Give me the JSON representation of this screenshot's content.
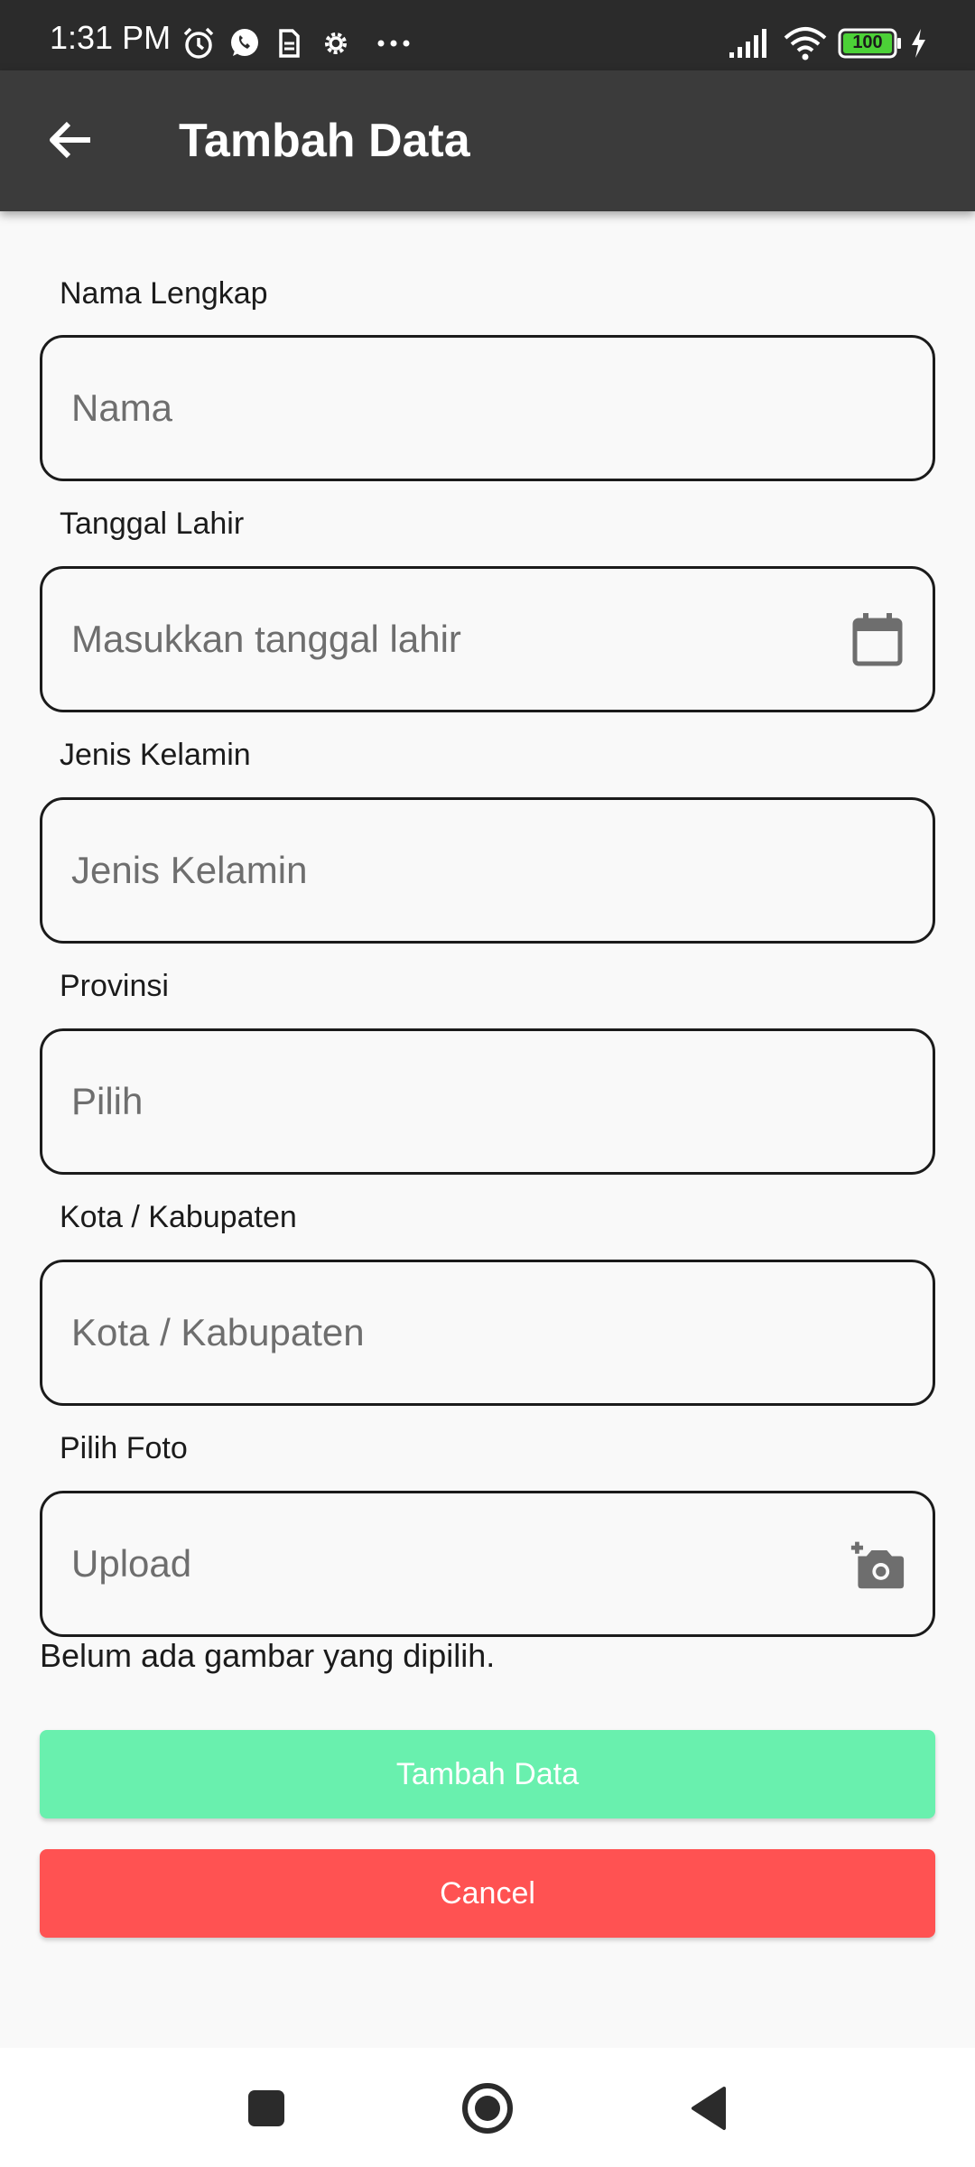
{
  "status_bar": {
    "time": "1:31 PM",
    "battery": "100",
    "icons": [
      "alarm-icon",
      "whatsapp-icon",
      "sim-icon",
      "settings-icon",
      "more-dots-icon",
      "signal-icon",
      "wifi-icon",
      "battery-icon",
      "charging-icon"
    ]
  },
  "app_bar": {
    "title": "Tambah Data",
    "back_icon": "arrow-back-icon"
  },
  "form": {
    "fields": [
      {
        "label": "Nama Lengkap",
        "placeholder": "Nama"
      },
      {
        "label": "Tanggal Lahir",
        "placeholder": "Masukkan tanggal lahir",
        "icon": "calendar-icon"
      },
      {
        "label": "Jenis Kelamin",
        "placeholder": "Jenis Kelamin"
      },
      {
        "label": "Provinsi",
        "placeholder": "Pilih"
      },
      {
        "label": "Kota / Kabupaten",
        "placeholder": "Kota / Kabupaten"
      },
      {
        "label": "Pilih Foto",
        "placeholder": "Upload",
        "icon": "add-photo-icon"
      }
    ],
    "no_image_text": "Belum ada gambar yang dipilih.",
    "submit_label": "Tambah Data",
    "cancel_label": "Cancel"
  },
  "nav_bar": {
    "buttons": [
      "recents-square-icon",
      "home-circle-icon",
      "back-triangle-icon"
    ]
  },
  "colors": {
    "status_bar": "#2b2b2b",
    "app_bar": "#3b3b3b",
    "background": "#f9f9f9",
    "submit_button": "#69f0ae",
    "cancel_button": "#ff5252",
    "placeholder_text": "#6e6e6e"
  }
}
